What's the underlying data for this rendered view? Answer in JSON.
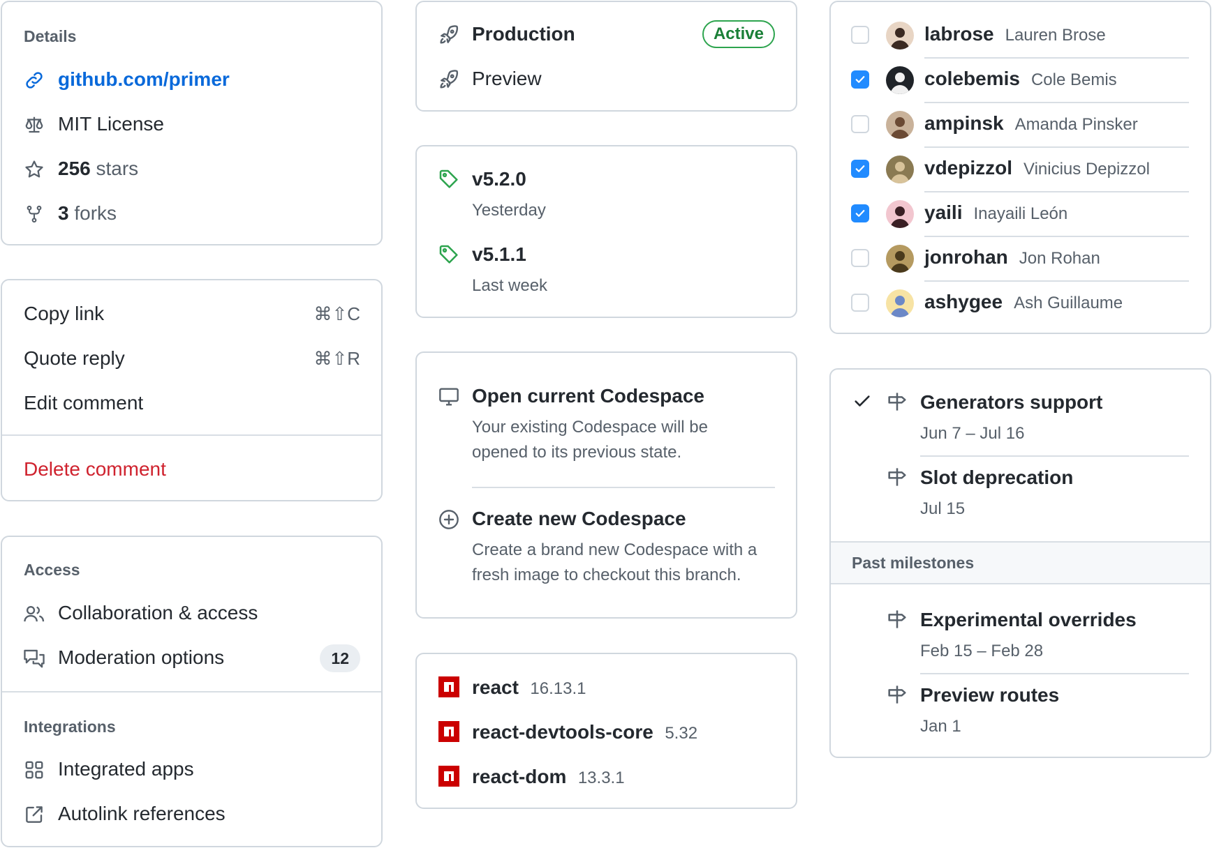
{
  "details": {
    "heading": "Details",
    "link": "github.com/primer",
    "license": "MIT License",
    "stars_count": "256",
    "stars_label": "stars",
    "forks_count": "3",
    "forks_label": "forks"
  },
  "actions": {
    "items": [
      {
        "label": "Copy link",
        "shortcut": "⌘⇧C"
      },
      {
        "label": "Quote reply",
        "shortcut": "⌘⇧R"
      },
      {
        "label": "Edit comment"
      }
    ],
    "danger": "Delete comment"
  },
  "settings": {
    "access_heading": "Access",
    "collab": "Collaboration & access",
    "moderation": "Moderation options",
    "moderation_count": "12",
    "integrations_heading": "Integrations",
    "integrated_apps": "Integrated apps",
    "autolink": "Autolink references"
  },
  "environments": {
    "production": "Production",
    "active_badge": "Active",
    "preview": "Preview"
  },
  "releases": [
    {
      "tag": "v5.2.0",
      "when": "Yesterday"
    },
    {
      "tag": "v5.1.1",
      "when": "Last week"
    }
  ],
  "codespaces": {
    "open_title": "Open current Codespace",
    "open_desc_1": "Your existing Codespace will be",
    "open_desc_2": "opened to its previous state.",
    "create_title": "Create new Codespace",
    "create_desc_1": "Create a brand new Codespace with a",
    "create_desc_2": "fresh image to checkout this branch."
  },
  "packages": [
    {
      "name": "react",
      "version": "16.13.1"
    },
    {
      "name": "react-devtools-core",
      "version": "5.32"
    },
    {
      "name": "react-dom",
      "version": "13.3.1"
    }
  ],
  "users": [
    {
      "login": "labrose",
      "name": "Lauren Brose",
      "checked": false
    },
    {
      "login": "colebemis",
      "name": "Cole Bemis",
      "checked": true
    },
    {
      "login": "ampinsk",
      "name": "Amanda Pinsker",
      "checked": false
    },
    {
      "login": "vdepizzol",
      "name": "Vinicius Depizzol",
      "checked": true
    },
    {
      "login": "yaili",
      "name": "Inayaili León",
      "checked": true
    },
    {
      "login": "jonrohan",
      "name": "Jon Rohan",
      "checked": false
    },
    {
      "login": "ashygee",
      "name": "Ash Guillaume",
      "checked": false
    }
  ],
  "milestones": {
    "current": [
      {
        "title": "Generators support",
        "dates": "Jun 7 – Jul 16",
        "selected": true
      },
      {
        "title": "Slot deprecation",
        "dates": "Jul 15",
        "selected": false
      }
    ],
    "past_heading": "Past milestones",
    "past": [
      {
        "title": "Experimental overrides",
        "dates": "Feb 15 – Feb 28"
      },
      {
        "title": "Preview routes",
        "dates": "Jan 1"
      }
    ]
  },
  "colors": {
    "link": "#0969da",
    "danger": "#cf222e",
    "success": "#1a7f37",
    "checkbox": "#218bff",
    "npm": "#cb0000"
  }
}
